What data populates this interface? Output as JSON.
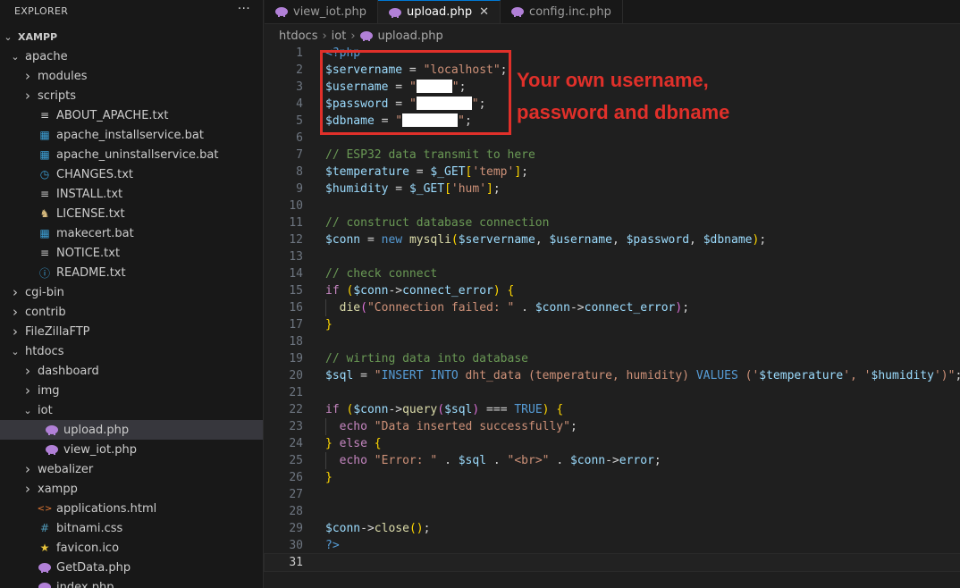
{
  "sidebar": {
    "title": "EXPLORER",
    "more": "···",
    "items": [
      {
        "label": "XAMPP",
        "depth": 0,
        "chev": "v",
        "icon": "",
        "bold": true
      },
      {
        "label": "apache",
        "depth": 1,
        "chev": "v",
        "icon": ""
      },
      {
        "label": "modules",
        "depth": 2,
        "chev": ">",
        "icon": ""
      },
      {
        "label": "scripts",
        "depth": 2,
        "chev": ">",
        "icon": ""
      },
      {
        "label": "ABOUT_APACHE.txt",
        "depth": 2,
        "chev": "",
        "icon": "lines-icon"
      },
      {
        "label": "apache_installservice.bat",
        "depth": 2,
        "chev": "",
        "icon": "windows-icon"
      },
      {
        "label": "apache_uninstallservice.bat",
        "depth": 2,
        "chev": "",
        "icon": "windows-icon"
      },
      {
        "label": "CHANGES.txt",
        "depth": 2,
        "chev": "",
        "icon": "clock-icon"
      },
      {
        "label": "INSTALL.txt",
        "depth": 2,
        "chev": "",
        "icon": "lines-icon"
      },
      {
        "label": "LICENSE.txt",
        "depth": 2,
        "chev": "",
        "icon": "license-icon"
      },
      {
        "label": "makecert.bat",
        "depth": 2,
        "chev": "",
        "icon": "windows-icon"
      },
      {
        "label": "NOTICE.txt",
        "depth": 2,
        "chev": "",
        "icon": "lines-icon"
      },
      {
        "label": "README.txt",
        "depth": 2,
        "chev": "",
        "icon": "info-icon"
      },
      {
        "label": "cgi-bin",
        "depth": 1,
        "chev": ">",
        "icon": ""
      },
      {
        "label": "contrib",
        "depth": 1,
        "chev": ">",
        "icon": ""
      },
      {
        "label": "FileZillaFTP",
        "depth": 1,
        "chev": ">",
        "icon": ""
      },
      {
        "label": "htdocs",
        "depth": 1,
        "chev": "v",
        "icon": ""
      },
      {
        "label": "dashboard",
        "depth": 2,
        "chev": ">",
        "icon": ""
      },
      {
        "label": "img",
        "depth": 2,
        "chev": ">",
        "icon": ""
      },
      {
        "label": "iot",
        "depth": 2,
        "chev": "v",
        "icon": ""
      },
      {
        "label": "upload.php",
        "depth": 3,
        "chev": "",
        "icon": "php-icon",
        "active": true
      },
      {
        "label": "view_iot.php",
        "depth": 3,
        "chev": "",
        "icon": "php-icon"
      },
      {
        "label": "webalizer",
        "depth": 2,
        "chev": ">",
        "icon": ""
      },
      {
        "label": "xampp",
        "depth": 2,
        "chev": ">",
        "icon": ""
      },
      {
        "label": "applications.html",
        "depth": 2,
        "chev": "",
        "icon": "html-icon"
      },
      {
        "label": "bitnami.css",
        "depth": 2,
        "chev": "",
        "icon": "hash-icon"
      },
      {
        "label": "favicon.ico",
        "depth": 2,
        "chev": "",
        "icon": "star-icon"
      },
      {
        "label": "GetData.php",
        "depth": 2,
        "chev": "",
        "icon": "php-icon"
      },
      {
        "label": "index.php",
        "depth": 2,
        "chev": "",
        "icon": "php-icon"
      }
    ]
  },
  "tabs": [
    {
      "label": "view_iot.php",
      "active": false
    },
    {
      "label": "upload.php",
      "active": true,
      "close": "✕"
    },
    {
      "label": "config.inc.php",
      "active": false
    }
  ],
  "breadcrumb": [
    "htdocs",
    "iot",
    "upload.php"
  ],
  "annotation": {
    "line1": "Your own username,",
    "line2": "password and dbname"
  },
  "colors": {
    "accent": "#0078d4",
    "annotation": "#e0302a",
    "php_icon": "#b180d7"
  },
  "code": [
    [
      {
        "t": "<?php",
        "c": "k"
      }
    ],
    [
      {
        "t": "$servername",
        "c": "v"
      },
      {
        "t": " = ",
        "c": "p"
      },
      {
        "t": "\"localhost\"",
        "c": "s"
      },
      {
        "t": ";",
        "c": "p"
      }
    ],
    [
      {
        "t": "$username",
        "c": "v"
      },
      {
        "t": " = ",
        "c": "p"
      },
      {
        "t": "\"",
        "c": "s"
      },
      {
        "r": 40
      },
      {
        "t": "\"",
        "c": "s"
      },
      {
        "t": ";",
        "c": "p"
      }
    ],
    [
      {
        "t": "$password",
        "c": "v"
      },
      {
        "t": " = ",
        "c": "p"
      },
      {
        "t": "\"",
        "c": "s"
      },
      {
        "r": 62
      },
      {
        "t": "\"",
        "c": "s"
      },
      {
        "t": ";",
        "c": "p"
      }
    ],
    [
      {
        "t": "$dbname",
        "c": "v"
      },
      {
        "t": " = ",
        "c": "p"
      },
      {
        "t": "\"",
        "c": "s"
      },
      {
        "r": 62
      },
      {
        "t": "\"",
        "c": "s"
      },
      {
        "t": ";",
        "c": "p"
      }
    ],
    [],
    [
      {
        "t": "// ESP32 data transmit to here",
        "c": "c"
      }
    ],
    [
      {
        "t": "$temperature",
        "c": "v"
      },
      {
        "t": " = ",
        "c": "p"
      },
      {
        "t": "$_GET",
        "c": "v"
      },
      {
        "t": "[",
        "c": "b"
      },
      {
        "t": "'temp'",
        "c": "s"
      },
      {
        "t": "]",
        "c": "b"
      },
      {
        "t": ";",
        "c": "p"
      }
    ],
    [
      {
        "t": "$humidity",
        "c": "v"
      },
      {
        "t": " = ",
        "c": "p"
      },
      {
        "t": "$_GET",
        "c": "v"
      },
      {
        "t": "[",
        "c": "b"
      },
      {
        "t": "'hum'",
        "c": "s"
      },
      {
        "t": "]",
        "c": "b"
      },
      {
        "t": ";",
        "c": "p"
      }
    ],
    [],
    [
      {
        "t": "// construct database connection",
        "c": "c"
      }
    ],
    [
      {
        "t": "$conn",
        "c": "v"
      },
      {
        "t": " = ",
        "c": "p"
      },
      {
        "t": "new",
        "c": "nw"
      },
      {
        "t": " ",
        "c": "p"
      },
      {
        "t": "mysqli",
        "c": "f"
      },
      {
        "t": "(",
        "c": "b"
      },
      {
        "t": "$servername",
        "c": "v"
      },
      {
        "t": ", ",
        "c": "p"
      },
      {
        "t": "$username",
        "c": "v"
      },
      {
        "t": ", ",
        "c": "p"
      },
      {
        "t": "$password",
        "c": "v"
      },
      {
        "t": ", ",
        "c": "p"
      },
      {
        "t": "$dbname",
        "c": "v"
      },
      {
        "t": ")",
        "c": "b"
      },
      {
        "t": ";",
        "c": "p"
      }
    ],
    [],
    [
      {
        "t": "// check connect",
        "c": "c"
      }
    ],
    [
      {
        "t": "if",
        "c": "kc"
      },
      {
        "t": " ",
        "c": "p"
      },
      {
        "t": "(",
        "c": "b"
      },
      {
        "t": "$conn",
        "c": "v"
      },
      {
        "t": "->",
        "c": "p"
      },
      {
        "t": "connect_error",
        "c": "v"
      },
      {
        "t": ")",
        "c": "b"
      },
      {
        "t": " ",
        "c": "p"
      },
      {
        "t": "{",
        "c": "b"
      }
    ],
    [
      {
        "t": "  ",
        "c": "p"
      },
      {
        "t": "die",
        "c": "f"
      },
      {
        "t": "(",
        "c": "b2"
      },
      {
        "t": "\"Connection failed: \"",
        "c": "s"
      },
      {
        "t": " . ",
        "c": "p"
      },
      {
        "t": "$conn",
        "c": "v"
      },
      {
        "t": "->",
        "c": "p"
      },
      {
        "t": "connect_error",
        "c": "v"
      },
      {
        "t": ")",
        "c": "b2"
      },
      {
        "t": ";",
        "c": "p"
      }
    ],
    [
      {
        "t": "}",
        "c": "b"
      }
    ],
    [],
    [
      {
        "t": "// wirting data into database",
        "c": "c"
      }
    ],
    [
      {
        "t": "$sql",
        "c": "v"
      },
      {
        "t": " = ",
        "c": "p"
      },
      {
        "t": "\"",
        "c": "s"
      },
      {
        "t": "INSERT INTO",
        "c": "k"
      },
      {
        "t": " dht_data (temperature, humidity) ",
        "c": "s"
      },
      {
        "t": "VALUES",
        "c": "k"
      },
      {
        "t": " (",
        "c": "s"
      },
      {
        "t": "'",
        "c": "s"
      },
      {
        "t": "$temperature",
        "c": "v"
      },
      {
        "t": "', '",
        "c": "s"
      },
      {
        "t": "$humidity",
        "c": "v"
      },
      {
        "t": "')\"",
        "c": "s"
      },
      {
        "t": ";",
        "c": "p"
      }
    ],
    [],
    [
      {
        "t": "if",
        "c": "kc"
      },
      {
        "t": " ",
        "c": "p"
      },
      {
        "t": "(",
        "c": "b"
      },
      {
        "t": "$conn",
        "c": "v"
      },
      {
        "t": "->",
        "c": "p"
      },
      {
        "t": "query",
        "c": "f"
      },
      {
        "t": "(",
        "c": "b2"
      },
      {
        "t": "$sql",
        "c": "v"
      },
      {
        "t": ")",
        "c": "b2"
      },
      {
        "t": " === ",
        "c": "p"
      },
      {
        "t": "TRUE",
        "c": "k"
      },
      {
        "t": ")",
        "c": "b"
      },
      {
        "t": " ",
        "c": "p"
      },
      {
        "t": "{",
        "c": "b"
      }
    ],
    [
      {
        "t": "  ",
        "c": "p"
      },
      {
        "t": "echo",
        "c": "kc"
      },
      {
        "t": " ",
        "c": "p"
      },
      {
        "t": "\"Data inserted successfully\"",
        "c": "s"
      },
      {
        "t": ";",
        "c": "p"
      }
    ],
    [
      {
        "t": "}",
        "c": "b"
      },
      {
        "t": " ",
        "c": "p"
      },
      {
        "t": "else",
        "c": "kc"
      },
      {
        "t": " ",
        "c": "p"
      },
      {
        "t": "{",
        "c": "b"
      }
    ],
    [
      {
        "t": "  ",
        "c": "p"
      },
      {
        "t": "echo",
        "c": "kc"
      },
      {
        "t": " ",
        "c": "p"
      },
      {
        "t": "\"Error: \"",
        "c": "s"
      },
      {
        "t": " . ",
        "c": "p"
      },
      {
        "t": "$sql",
        "c": "v"
      },
      {
        "t": " . ",
        "c": "p"
      },
      {
        "t": "\"<br>\"",
        "c": "s"
      },
      {
        "t": " . ",
        "c": "p"
      },
      {
        "t": "$conn",
        "c": "v"
      },
      {
        "t": "->",
        "c": "p"
      },
      {
        "t": "error",
        "c": "v"
      },
      {
        "t": ";",
        "c": "p"
      }
    ],
    [
      {
        "t": "}",
        "c": "b"
      }
    ],
    [],
    [],
    [
      {
        "t": "$conn",
        "c": "v"
      },
      {
        "t": "->",
        "c": "p"
      },
      {
        "t": "close",
        "c": "f"
      },
      {
        "t": "(",
        "c": "b"
      },
      {
        "t": ")",
        "c": "b"
      },
      {
        "t": ";",
        "c": "p"
      }
    ],
    [
      {
        "t": "?>",
        "c": "k"
      }
    ],
    []
  ],
  "current_line": 31
}
